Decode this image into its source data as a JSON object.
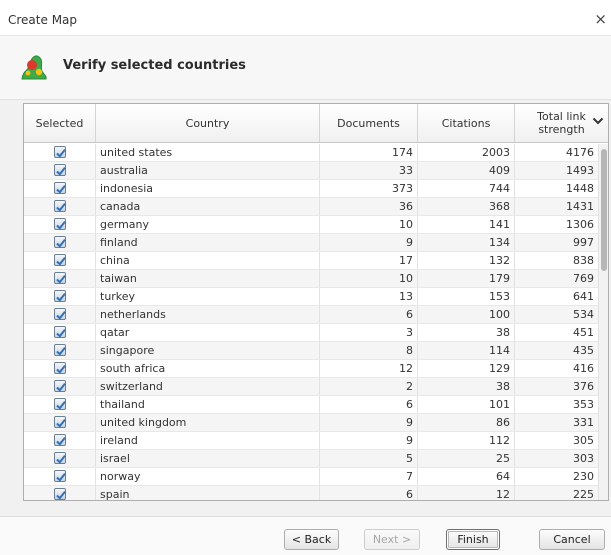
{
  "window": {
    "title": "Create Map",
    "close_glyph": "×"
  },
  "banner": {
    "heading": "Verify selected countries",
    "icon": "vosviewer-map-icon"
  },
  "table": {
    "columns": [
      "Selected",
      "Country",
      "Documents",
      "Citations",
      "Total link strength"
    ],
    "sort_column": "Total link strength",
    "sort_direction": "descending",
    "rows": [
      {
        "selected": true,
        "country": "united states",
        "documents": "174",
        "citations": "2003",
        "strength": "4176"
      },
      {
        "selected": true,
        "country": "australia",
        "documents": "33",
        "citations": "409",
        "strength": "1493"
      },
      {
        "selected": true,
        "country": "indonesia",
        "documents": "373",
        "citations": "744",
        "strength": "1448"
      },
      {
        "selected": true,
        "country": "canada",
        "documents": "36",
        "citations": "368",
        "strength": "1431"
      },
      {
        "selected": true,
        "country": "germany",
        "documents": "10",
        "citations": "141",
        "strength": "1306"
      },
      {
        "selected": true,
        "country": "finland",
        "documents": "9",
        "citations": "134",
        "strength": "997"
      },
      {
        "selected": true,
        "country": "china",
        "documents": "17",
        "citations": "132",
        "strength": "838"
      },
      {
        "selected": true,
        "country": "taiwan",
        "documents": "10",
        "citations": "179",
        "strength": "769"
      },
      {
        "selected": true,
        "country": "turkey",
        "documents": "13",
        "citations": "153",
        "strength": "641"
      },
      {
        "selected": true,
        "country": "netherlands",
        "documents": "6",
        "citations": "100",
        "strength": "534"
      },
      {
        "selected": true,
        "country": "qatar",
        "documents": "3",
        "citations": "38",
        "strength": "451"
      },
      {
        "selected": true,
        "country": "singapore",
        "documents": "8",
        "citations": "114",
        "strength": "435"
      },
      {
        "selected": true,
        "country": "south africa",
        "documents": "12",
        "citations": "129",
        "strength": "416"
      },
      {
        "selected": true,
        "country": "switzerland",
        "documents": "2",
        "citations": "38",
        "strength": "376"
      },
      {
        "selected": true,
        "country": "thailand",
        "documents": "6",
        "citations": "101",
        "strength": "353"
      },
      {
        "selected": true,
        "country": "united kingdom",
        "documents": "9",
        "citations": "86",
        "strength": "331"
      },
      {
        "selected": true,
        "country": "ireland",
        "documents": "9",
        "citations": "112",
        "strength": "305"
      },
      {
        "selected": true,
        "country": "israel",
        "documents": "5",
        "citations": "25",
        "strength": "303"
      },
      {
        "selected": true,
        "country": "norway",
        "documents": "7",
        "citations": "64",
        "strength": "230"
      },
      {
        "selected": true,
        "country": "spain",
        "documents": "6",
        "citations": "12",
        "strength": "225"
      }
    ]
  },
  "buttons": {
    "back": "< Back",
    "next": "Next >",
    "finish": "Finish",
    "cancel": "Cancel"
  },
  "colors": {
    "check": "#2f6fb5",
    "icon_green": "#3faa4a",
    "icon_red": "#d93a2b",
    "icon_yellow": "#f1c40f"
  }
}
